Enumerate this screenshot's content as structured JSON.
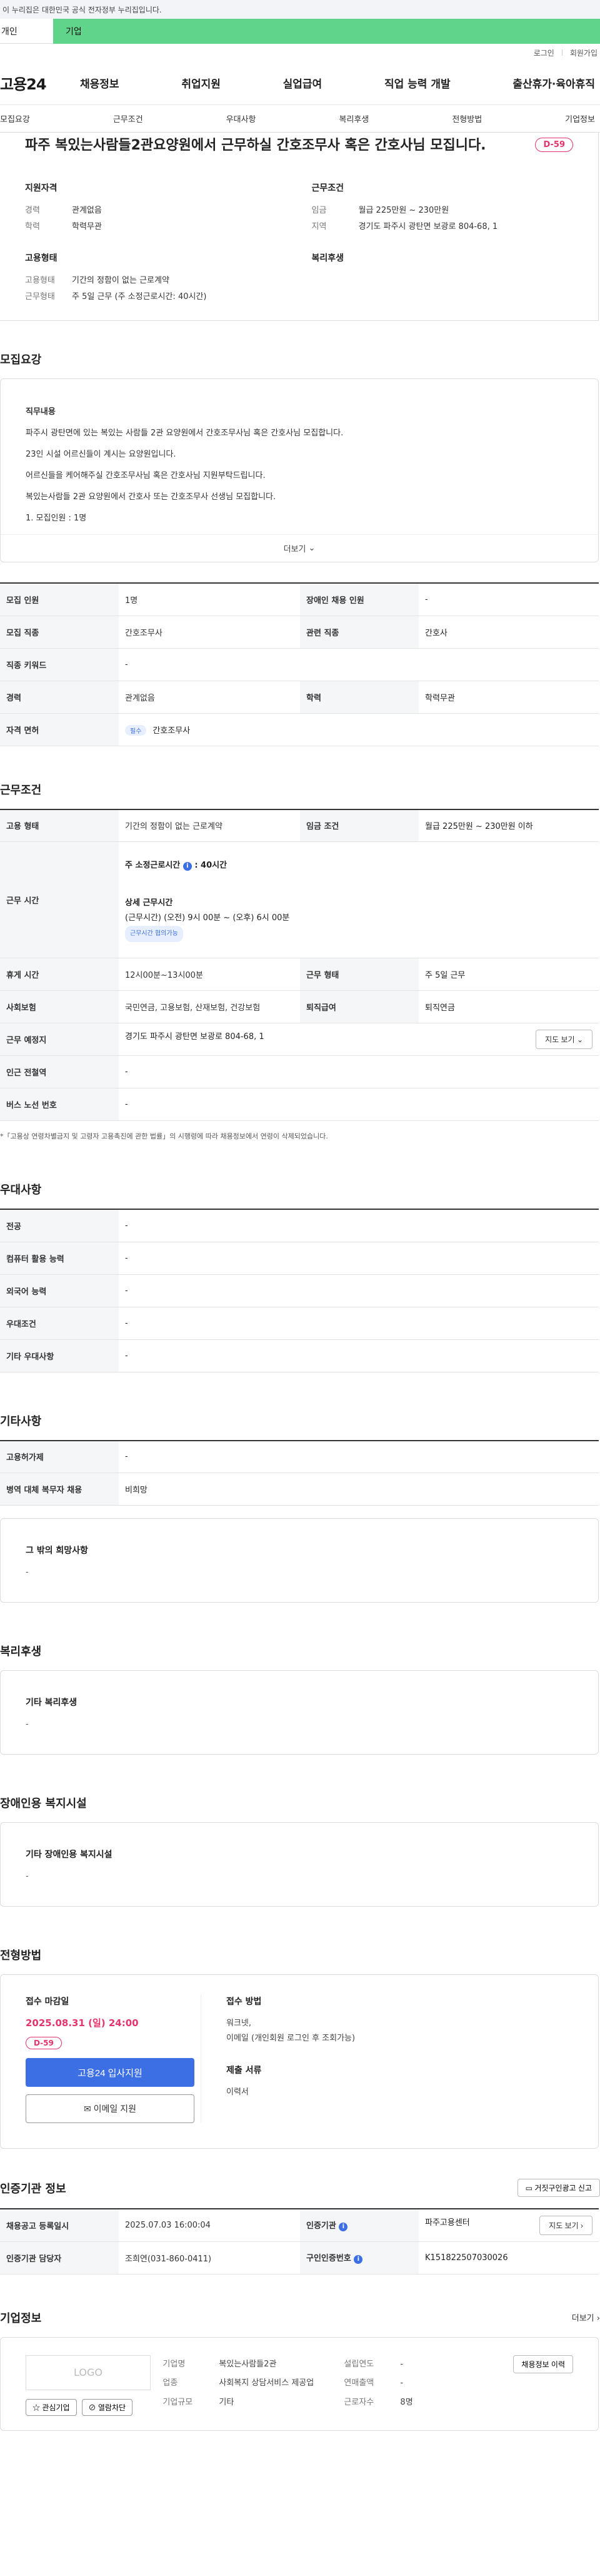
{
  "gov_banner": "이 누리집은 대한민국 공식 전자정부 누리집입니다.",
  "top_tabs": [
    "개인",
    "기업"
  ],
  "util": [
    "로그인",
    "회원가입"
  ],
  "logo": "고용24",
  "gnb": [
    "채용정보",
    "취업지원",
    "실업급여",
    "직업 능력 개발",
    "출산휴가·육아휴직"
  ],
  "subnav": [
    "모집요강",
    "근무조건",
    "우대사항",
    "복리후생",
    "전형방법",
    "기업정보"
  ],
  "title": "파주 복있는사람들2관요양원에서 근무하실 간호조무사 혹은 간호사님 모집니다.",
  "dday": "D-59",
  "summary": {
    "qual_title": "지원자격",
    "qual": [
      {
        "k": "경력",
        "v": "관계없음"
      },
      {
        "k": "학력",
        "v": "학력무관"
      }
    ],
    "cond_title": "근무조건",
    "cond": [
      {
        "k": "임금",
        "v": "월급 225만원 ~ 230만원"
      },
      {
        "k": "지역",
        "v": "경기도 파주시 광탄면 보광로 804-68, 1"
      }
    ],
    "emp_title": "고용형태",
    "emp": [
      {
        "k": "고용형태",
        "v": "기간의 정함이 없는 근로계약"
      },
      {
        "k": "근무형태",
        "v": "주 5일 근무 (주 소정근로시간: 40시간)"
      }
    ],
    "welfare_title": "복리후생"
  },
  "recruit": {
    "heading": "모집요강",
    "job_title": "직무내용",
    "lines": [
      "파주시 광탄면에 있는 복있는 사람들 2관 요양원에서 간호조무사님 혹은 간호사님 모집합니다.",
      "23인 시설 어르신들이 계시는 요양원입니다.",
      "어르신들을 케어해주실 간호조무사님 혹은 간호사님 지원부탁드립니다.",
      "복있는사람들 2관 요양원에서 간호사 또는 간호조무사 선생님 모집합니다.",
      "1. 모집인원 : 1명"
    ],
    "more": "더보기"
  },
  "recruit_table": {
    "r1": [
      "모집 인원",
      "1명",
      "장애인 채용 인원",
      "-"
    ],
    "r2": [
      "모집 직종",
      "간호조무사",
      "관련 직종",
      "간호사"
    ],
    "r3": [
      "직종 키워드",
      "-"
    ],
    "r4": [
      "경력",
      "관계없음",
      "학력",
      "학력무관"
    ],
    "r5": [
      "자격 면허",
      "필수",
      "간호조무사"
    ]
  },
  "work": {
    "heading": "근무조건",
    "r1": [
      "고용 형태",
      "기간의 정함이 없는 근로계약",
      "임금 조건",
      "월급 225만원 ~ 230만원 이하"
    ],
    "time_label": "근무 시간",
    "weekly": "주 소정근로시간",
    "weekly_val": ": 40시간",
    "detail_title": "상세 근무시간",
    "detail": "(근무시간) (오전) 9시 00분 ~ (오후) 6시 00분",
    "flex": "근무시간 협의가능",
    "r3": [
      "휴게 시간",
      "12시00분~13시00분",
      "근무 형태",
      "주 5일 근무"
    ],
    "r4": [
      "사회보험",
      "국민연금, 고용보험, 산재보험, 건강보험",
      "퇴직급여",
      "퇴직연금"
    ],
    "r5": [
      "근무 예정지",
      "경기도 파주시 광탄면 보광로 804-68, 1",
      "지도 보기"
    ],
    "r6": [
      "인근 전철역",
      "-"
    ],
    "r7": [
      "버스 노선 번호",
      "-"
    ],
    "note": "*「고용상 연령차별금지 및 고령자 고용촉진에 관한 법률」의 시행령에 따라 채용정보에서 연령이 삭제되었습니다."
  },
  "pref": {
    "heading": "우대사항",
    "rows": [
      [
        "전공",
        "-"
      ],
      [
        "컴퓨터 활용 능력",
        "-"
      ],
      [
        "외국어 능력",
        "-"
      ],
      [
        "우대조건",
        "-"
      ],
      [
        "기타 우대사항",
        "-"
      ]
    ]
  },
  "etc": {
    "heading": "기타사항",
    "rows": [
      [
        "고용허가제",
        "-"
      ],
      [
        "병역 대체 복무자 채용",
        "비희망"
      ]
    ],
    "box_title": "그 밖의 희망사항",
    "box_val": "-"
  },
  "welfare": {
    "heading": "복리후생",
    "box_title": "기타 복리후생",
    "box_val": "-"
  },
  "disability": {
    "heading": "장애인용 복지시설",
    "box_title": "기타 장애인용 복지시설",
    "box_val": "-"
  },
  "apply": {
    "heading": "전형방법",
    "deadline_title": "접수 마감일",
    "deadline": "2025.08.31 (일) 24:00",
    "dday": "D-59",
    "btn_primary": "고용24 입사지원",
    "btn_email": "이메일 지원",
    "method_title": "접수 방법",
    "method": "워크넷,",
    "method2": "이메일 (개인회원 로그인 후 조회가능)",
    "docs_title": "제출 서류",
    "docs": "이력서"
  },
  "cert": {
    "heading": "인증기관 정보",
    "btn": "거짓구인광고 신고",
    "r1": [
      "채용공고 등록일시",
      "2025.07.03 16:00:04",
      "인증기관",
      "파주고용센터",
      "지도 보기"
    ],
    "r2": [
      "인증기관 담당자",
      "조희연(031-860-0411)",
      "구인인증번호",
      "K151822507030026"
    ]
  },
  "company": {
    "heading": "기업정보",
    "more": "더보기",
    "logo_ph": "LOGO",
    "btn_fav": "관심기업",
    "btn_block": "열람차단",
    "k1": "기업명",
    "v1": "복있는사람들2관",
    "k2": "업종",
    "v2": "사회복지 상담서비스 제공업",
    "k3": "기업규모",
    "v3": "기타",
    "k4": "설립연도",
    "v4": "-",
    "k5": "연매출액",
    "v5": "-",
    "k6": "근로자수",
    "v6": "8명",
    "btn_list": "채용정보 이력"
  }
}
